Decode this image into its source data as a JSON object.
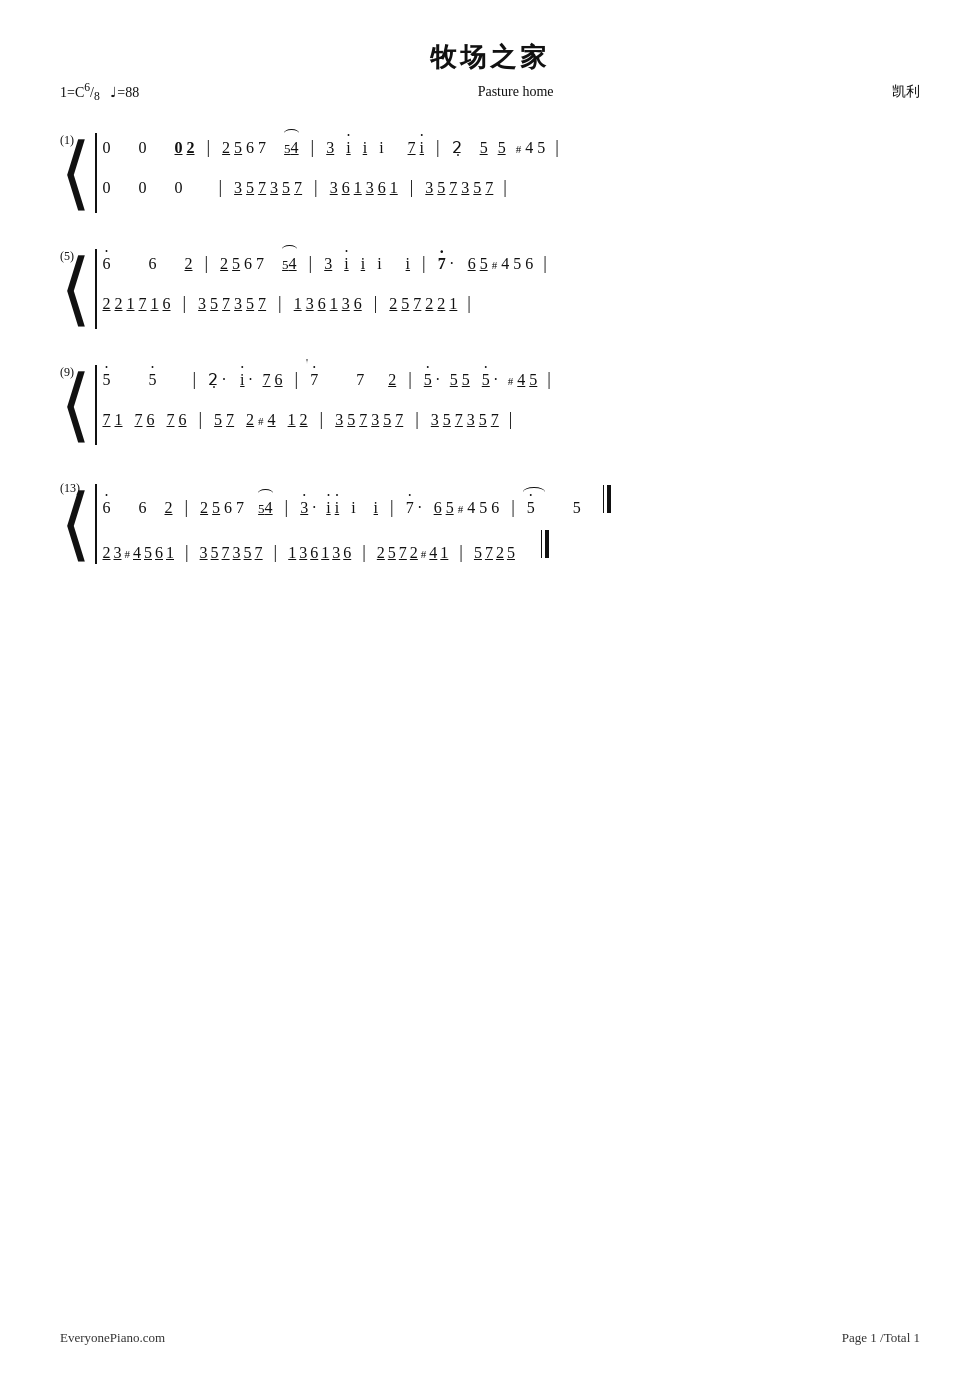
{
  "title": {
    "chinese": "牧场之家",
    "english": "Pasture home",
    "composer": "凯利"
  },
  "meta": {
    "key": "1=C",
    "time": "6/8",
    "tempo": "♩=88"
  },
  "footer": {
    "website": "EveryonePiano.com",
    "page": "Page 1 /Total 1"
  }
}
